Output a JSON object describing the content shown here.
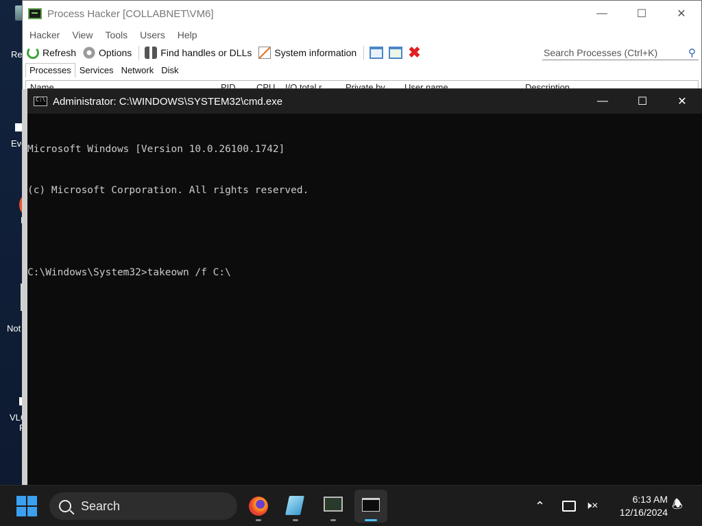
{
  "desktop": {
    "icons": [
      {
        "label": "Rec",
        "name": "recycle-bin"
      },
      {
        "label": "Eve",
        "name": "everything-shortcut"
      },
      {
        "label": "F",
        "name": "firefox-shortcut"
      },
      {
        "label": "Not",
        "name": "notepad-shortcut"
      },
      {
        "label": "VLC",
        "name": "vlc-shortcut"
      },
      {
        "label": "P",
        "name": "vlc-shortcut-line2"
      }
    ]
  },
  "process_hacker": {
    "title": "Process Hacker [COLLABNET\\VM6]",
    "menu": [
      "Hacker",
      "View",
      "Tools",
      "Users",
      "Help"
    ],
    "toolbar": {
      "refresh": "Refresh",
      "options": "Options",
      "find": "Find handles or DLLs",
      "sysinfo": "System information"
    },
    "search_placeholder": "Search Processes (Ctrl+K)",
    "tabs": [
      "Processes",
      "Services",
      "Network",
      "Disk"
    ],
    "columns": [
      "Name",
      "PID",
      "CPU",
      "I/O total r...",
      "Private by...",
      "User name",
      "Description"
    ]
  },
  "cmd": {
    "title": "Administrator: C:\\WINDOWS\\SYSTEM32\\cmd.exe",
    "lines": [
      "Microsoft Windows [Version 10.0.26100.1742]",
      "(c) Microsoft Corporation. All rights reserved.",
      "",
      "C:\\Windows\\System32>takeown /f C:\\"
    ]
  },
  "taskbar": {
    "search_label": "Search",
    "time": "6:13 AM",
    "date": "12/16/2024"
  },
  "colors": {
    "cmd_bg": "#0c0c0c",
    "cmd_text": "#cccccc",
    "taskbar_bg": "#1c1c1c",
    "accent": "#4cc2ff"
  }
}
